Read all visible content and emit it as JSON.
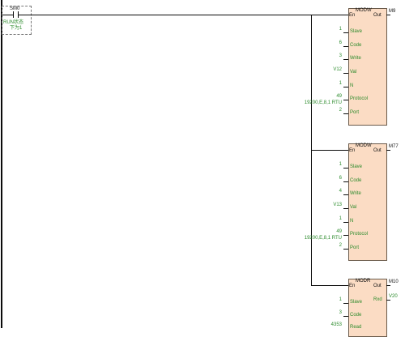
{
  "contact": {
    "address": "SM0",
    "comment_line1": "RUN状态",
    "comment_line2": "下为1"
  },
  "blocks": [
    {
      "name": "MODW",
      "en": "En",
      "out": "Out",
      "coil": "M9",
      "pins": [
        {
          "label": "Slave",
          "value": "1"
        },
        {
          "label": "Code",
          "value": "6"
        },
        {
          "label": "Write",
          "value": "3"
        },
        {
          "label": "Val",
          "value": "V12"
        },
        {
          "label": "N",
          "value": "1"
        },
        {
          "label": "Protocol",
          "value": "49"
        },
        {
          "label": "Port",
          "value": "2"
        }
      ],
      "protocol_note": "19200,E,8,1 RTU"
    },
    {
      "name": "MODW",
      "en": "En",
      "out": "Out",
      "coil": "M77",
      "pins": [
        {
          "label": "Slave",
          "value": "1"
        },
        {
          "label": "Code",
          "value": "6"
        },
        {
          "label": "Write",
          "value": "4"
        },
        {
          "label": "Val",
          "value": "V13"
        },
        {
          "label": "N",
          "value": "1"
        },
        {
          "label": "Protocol",
          "value": "49"
        },
        {
          "label": "Port",
          "value": "2"
        }
      ],
      "protocol_note": "19200,E,8,1 RTU"
    },
    {
      "name": "MODR",
      "en": "En",
      "out": "Out",
      "coil": "M10",
      "rxd_label": "Rxd",
      "rxd_value": "V20",
      "pins": [
        {
          "label": "Slave",
          "value": "1"
        },
        {
          "label": "Code",
          "value": "3"
        },
        {
          "label": "Read",
          "value": "4353"
        }
      ]
    }
  ],
  "colors": {
    "block_fill": "#fbdcc4",
    "param_green": "#2a8a2a",
    "wire": "#0a0a0a"
  }
}
